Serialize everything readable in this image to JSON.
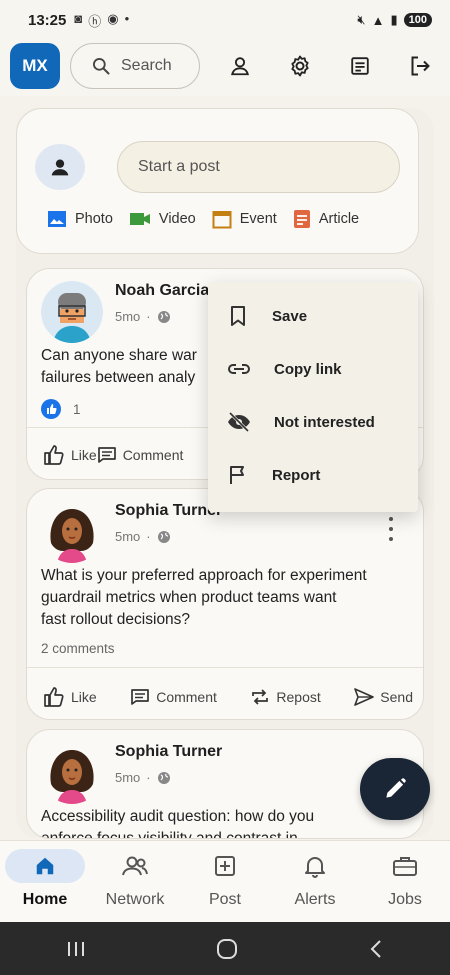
{
  "status_bar": {
    "time": "13:25",
    "battery": "100"
  },
  "top_bar": {
    "avatar_initials": "MX",
    "search_placeholder": "Search"
  },
  "composer": {
    "placeholder": "Start a post",
    "actions": [
      {
        "label": "Photo",
        "color": "#1a73e8"
      },
      {
        "label": "Video",
        "color": "#3c9a3c"
      },
      {
        "label": "Event",
        "color": "#c47f12"
      },
      {
        "label": "Article",
        "color": "#e0673f"
      }
    ]
  },
  "posts": [
    {
      "author": "Noah Garcia",
      "age": "5mo",
      "body": "Can anyone share war stories about failures between analy",
      "body_line1": "Can anyone share war",
      "body_line2": "failures between analy",
      "reactions": "1",
      "actions": [
        "Like",
        "Comment"
      ]
    },
    {
      "author": "Sophia Turner",
      "age": "5mo",
      "body_line1": "What is your preferred approach for experiment",
      "body_line2": "guardrail metrics when product teams want",
      "body_line3": "fast rollout decisions?",
      "comments": "2 comments",
      "actions": [
        "Like",
        "Comment",
        "Repost",
        "Send"
      ]
    },
    {
      "author": "Sophia Turner",
      "age": "5mo",
      "body_line1": "Accessibility audit question: how do you",
      "body_line2": "enforce focus visibility and contrast in"
    }
  ],
  "menu": {
    "items": [
      {
        "label": "Save",
        "icon": "bookmark-icon"
      },
      {
        "label": "Copy link",
        "icon": "link-icon"
      },
      {
        "label": "Not interested",
        "icon": "eye-off-icon"
      },
      {
        "label": "Report",
        "icon": "flag-icon"
      }
    ]
  },
  "bottom_nav": {
    "items": [
      {
        "label": "Home",
        "active": true
      },
      {
        "label": "Network"
      },
      {
        "label": "Post"
      },
      {
        "label": "Alerts"
      },
      {
        "label": "Jobs"
      }
    ]
  },
  "colors": {
    "brand": "#1167b8",
    "fab": "#1a2536",
    "background": "#f5f2ec"
  }
}
